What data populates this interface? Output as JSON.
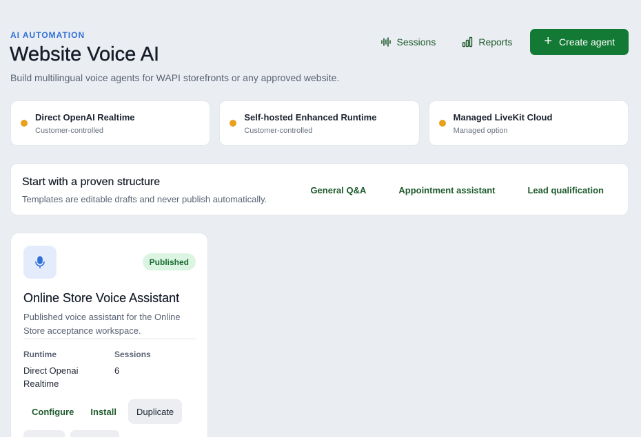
{
  "header": {
    "eyebrow": "AI AUTOMATION",
    "title": "Website Voice AI",
    "subtitle": "Build multilingual voice agents for WAPI storefronts or any approved website."
  },
  "top_actions": {
    "sessions_label": "Sessions",
    "reports_label": "Reports",
    "create_label": "Create agent"
  },
  "runtimes": [
    {
      "name": "Direct OpenAI Realtime",
      "sub": "Customer-controlled"
    },
    {
      "name": "Self-hosted Enhanced Runtime",
      "sub": "Customer-controlled"
    },
    {
      "name": "Managed LiveKit Cloud",
      "sub": "Managed option"
    }
  ],
  "templates": {
    "title": "Start with a proven structure",
    "subtitle": "Templates are editable drafts and never publish automatically.",
    "items": [
      "General Q&A",
      "Appointment assistant",
      "Lead qualification"
    ]
  },
  "agent": {
    "status": "Published",
    "name": "Online Store Voice Assistant",
    "description": "Published voice assistant for the Online Store acceptance workspace.",
    "runtime_label": "Runtime",
    "runtime_value": "Direct Openai Realtime",
    "sessions_label": "Sessions",
    "sessions_value": "6",
    "actions": {
      "configure": "Configure",
      "install": "Install",
      "duplicate": "Duplicate"
    }
  },
  "colors": {
    "accent_green": "#137a35",
    "link_green": "#1e5a2c",
    "eyebrow_blue": "#2f6fd6",
    "status_dot": "#e9a11b",
    "badge_bg": "#dcf5e3"
  }
}
